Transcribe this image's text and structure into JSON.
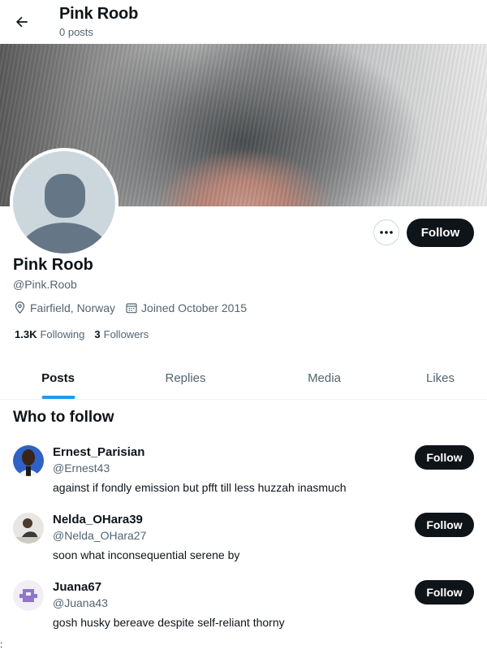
{
  "header": {
    "title": "Pink Roob",
    "subtitle": "0 posts"
  },
  "profile": {
    "name": "Pink Roob",
    "handle": "@Pink.Roob",
    "location": "Fairfield, Norway",
    "joined": "Joined October 2015",
    "following_count": "1.3K",
    "following_label": "Following",
    "followers_count": "3",
    "followers_label": "Followers",
    "follow_label": "Follow",
    "more_label": "•••"
  },
  "tabs": [
    {
      "label": "Posts",
      "active": true
    },
    {
      "label": "Replies",
      "active": false
    },
    {
      "label": "Media",
      "active": false
    },
    {
      "label": "Likes",
      "active": false
    }
  ],
  "who_to_follow": {
    "title": "Who to follow",
    "users": [
      {
        "name": "Ernest_Parisian",
        "handle": "@Ernest43",
        "bio": "against if fondly emission but pfft till less huzzah inasmuch",
        "button": "Follow"
      },
      {
        "name": "Nelda_OHara39",
        "handle": "@Nelda_OHara27",
        "bio": "soon what inconsequential serene by",
        "button": "Follow"
      },
      {
        "name": "Juana67",
        "handle": "@Juana43",
        "bio": "gosh husky bereave despite self-reliant thorny",
        "button": "Follow"
      }
    ]
  },
  "footer_mark": ":",
  "colors": {
    "accent": "#1d9bf0",
    "text": "#0f1419",
    "muted": "#536471",
    "button_bg": "#0f1419"
  },
  "icons": [
    "back-arrow-icon",
    "more-icon",
    "location-icon",
    "calendar-icon"
  ]
}
